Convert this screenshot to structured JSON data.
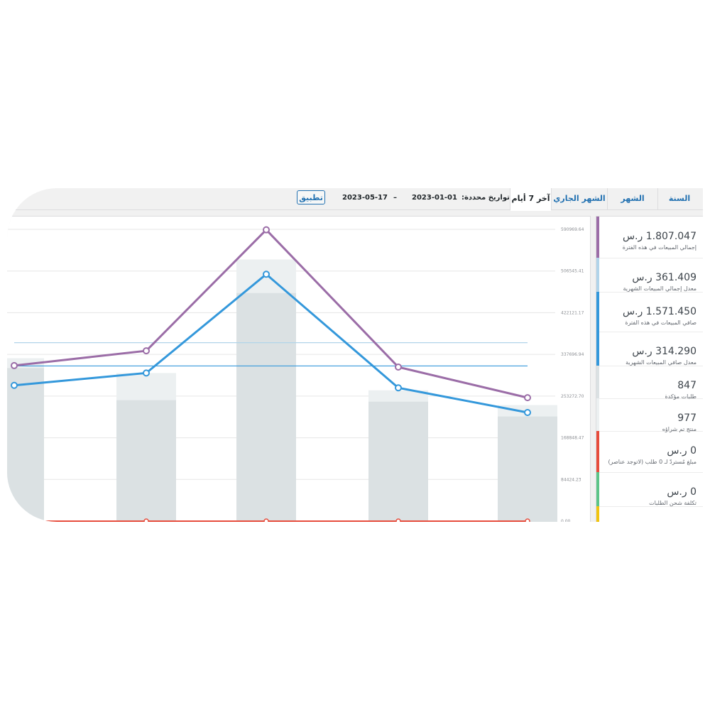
{
  "range_tabs": [
    {
      "label": "السنة الحالية",
      "active": false
    },
    {
      "label": "الشهر السابق",
      "active": false
    },
    {
      "label": "الشهر الجاري",
      "active": false
    },
    {
      "label": "آخر 7 أيام",
      "active": true
    }
  ],
  "custom_range": {
    "label": "تواريخ محددة:",
    "from": "2023-01-01",
    "separator": "–",
    "to": "2023-05-17",
    "apply_label": "تطبيق"
  },
  "legend": [
    {
      "value": "1.807.047 ر.س",
      "label": "إجمالي المبيعات في هذه الفترة",
      "color": "#9b6da7"
    },
    {
      "value": "361.409 ر.س",
      "label": "معدل إجمالي المبيعات الشهرية",
      "color": "#b1d4ea"
    },
    {
      "value": "1.571.450 ر.س",
      "label": "صافي المبيعات في هذه الفترة",
      "color": "#3498db"
    },
    {
      "value": "314.290 ر.س",
      "label": "معدل صافي المبيعات الشهرية",
      "color": "#3498db"
    },
    {
      "value": "847",
      "label": "طلبات مؤكدة",
      "color": "#dbe1e3"
    },
    {
      "value": "977",
      "label": "منتج تم شراؤه",
      "color": "#ecf0f1"
    },
    {
      "value": "0 ر.س",
      "label": "مبلغ مُستردّ لـ 0 طلب (لاتوجد عناصر)",
      "color": "#e74c3c"
    },
    {
      "value": "0 ر.س",
      "label": "تكلفة شحن الطلبات",
      "color": "#5cc488"
    },
    {
      "value": "",
      "label": "",
      "color": "#f1c40f"
    }
  ],
  "chart_data": {
    "type": "line",
    "yticks": [
      "590969.64",
      "506545.41",
      "422121.17",
      "337696.94",
      "253272.70",
      "168848.47",
      "84424.23",
      "0.00"
    ],
    "ylim": [
      0,
      590969.64
    ],
    "x": [
      0,
      1,
      2,
      3,
      4
    ],
    "series": [
      {
        "name": "إجمالي المبيعات في هذه الفترة",
        "type": "line",
        "color": "#9b6da7",
        "values": [
          315000,
          345000,
          590000,
          312000,
          250000
        ]
      },
      {
        "name": "صافي المبيعات في هذه الفترة",
        "type": "line",
        "color": "#3498db",
        "values": [
          275000,
          300000,
          500000,
          270000,
          220000
        ]
      },
      {
        "name": "معدل إجمالي المبيعات الشهرية",
        "type": "hline",
        "color": "#b1d4ea",
        "values": [
          361409
        ]
      },
      {
        "name": "معدل صافي المبيعات الشهرية",
        "type": "hline",
        "color": "#3498db",
        "values": [
          314290
        ]
      },
      {
        "name": "منتج تم شراؤه",
        "type": "bar",
        "color": "#ecf0f1",
        "values": [
          330000,
          300000,
          530000,
          265000,
          235000
        ]
      },
      {
        "name": "طلبات مؤكدة",
        "type": "bar",
        "color": "#dbe1e3",
        "values": [
          310000,
          245000,
          462000,
          242000,
          212000
        ]
      },
      {
        "name": "مبلغ مُستردّ لـ 0 طلب (لاتوجد عناصر)",
        "type": "line",
        "color": "#e74c3c",
        "values": [
          0,
          0,
          0,
          0,
          0
        ]
      }
    ]
  }
}
